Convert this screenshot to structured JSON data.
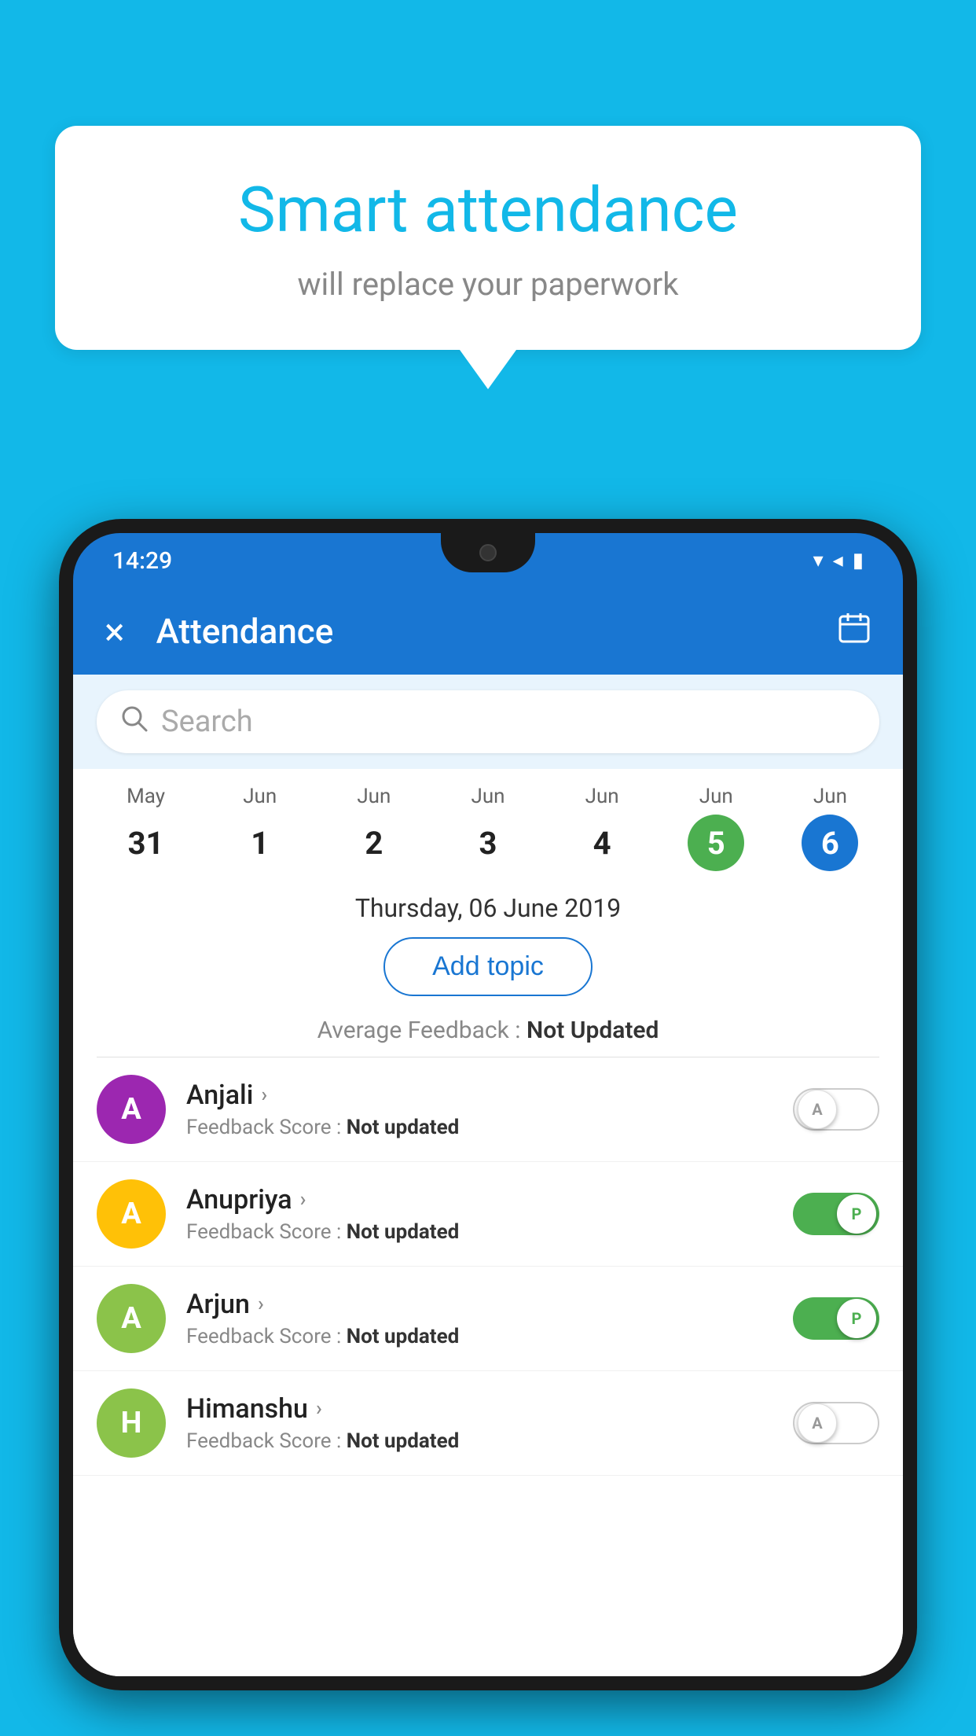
{
  "background": {
    "color": "#12b8e8"
  },
  "speech_bubble": {
    "title": "Smart attendance",
    "subtitle": "will replace your paperwork"
  },
  "phone": {
    "status_bar": {
      "time": "14:29",
      "icons": [
        "wifi",
        "signal",
        "battery"
      ]
    },
    "toolbar": {
      "close_label": "×",
      "title": "Attendance",
      "calendar_icon": "📅"
    },
    "search": {
      "placeholder": "Search"
    },
    "calendar": {
      "days": [
        {
          "month": "May",
          "day": "31",
          "state": "normal"
        },
        {
          "month": "Jun",
          "day": "1",
          "state": "normal"
        },
        {
          "month": "Jun",
          "day": "2",
          "state": "normal"
        },
        {
          "month": "Jun",
          "day": "3",
          "state": "normal"
        },
        {
          "month": "Jun",
          "day": "4",
          "state": "normal"
        },
        {
          "month": "Jun",
          "day": "5",
          "state": "today"
        },
        {
          "month": "Jun",
          "day": "6",
          "state": "selected"
        }
      ]
    },
    "selected_date": "Thursday, 06 June 2019",
    "add_topic_label": "Add topic",
    "avg_feedback_label": "Average Feedback :",
    "avg_feedback_value": "Not Updated",
    "students": [
      {
        "name": "Anjali",
        "avatar_letter": "A",
        "avatar_color": "#9c27b0",
        "feedback_label": "Feedback Score :",
        "feedback_value": "Not updated",
        "toggle_state": "off",
        "toggle_label": "A"
      },
      {
        "name": "Anupriya",
        "avatar_letter": "A",
        "avatar_color": "#ffc107",
        "feedback_label": "Feedback Score :",
        "feedback_value": "Not updated",
        "toggle_state": "on",
        "toggle_label": "P"
      },
      {
        "name": "Arjun",
        "avatar_letter": "A",
        "avatar_color": "#8bc34a",
        "feedback_label": "Feedback Score :",
        "feedback_value": "Not updated",
        "toggle_state": "on",
        "toggle_label": "P"
      },
      {
        "name": "Himanshu",
        "avatar_letter": "H",
        "avatar_color": "#8bc34a",
        "feedback_label": "Feedback Score :",
        "feedback_value": "Not updated",
        "toggle_state": "off",
        "toggle_label": "A"
      }
    ]
  }
}
